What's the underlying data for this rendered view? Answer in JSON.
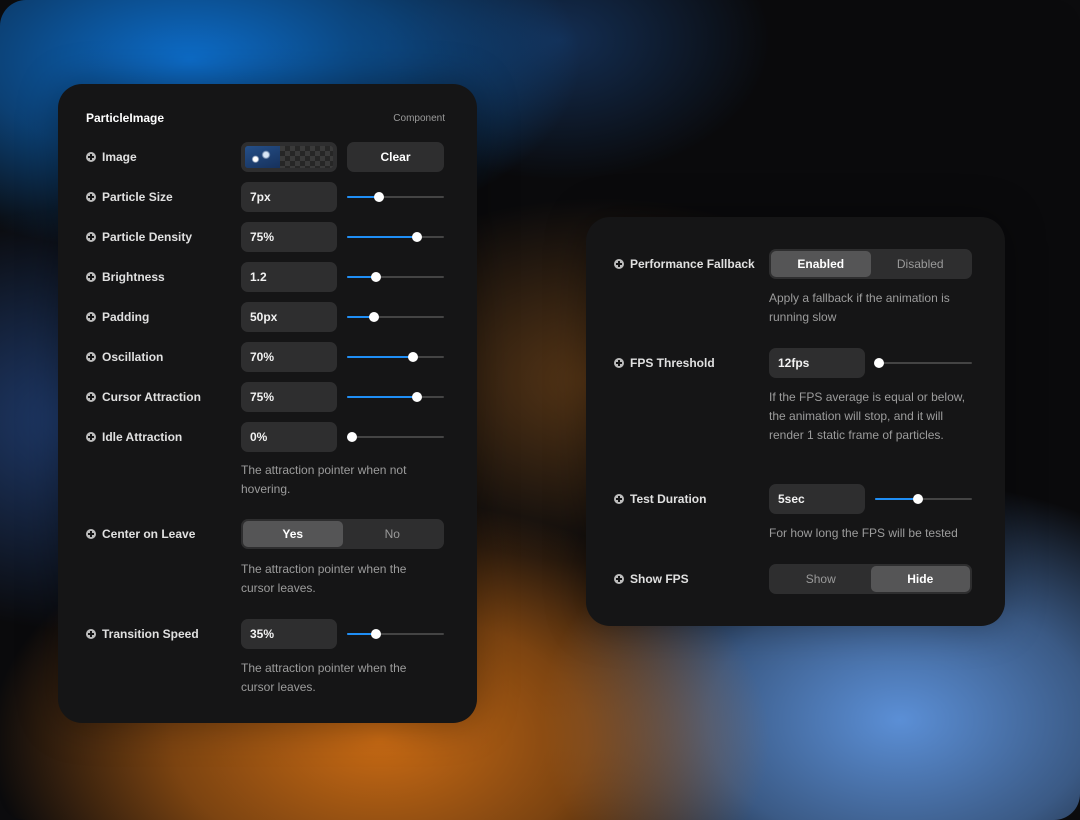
{
  "left_panel": {
    "title": "ParticleImage",
    "type_label": "Component",
    "image": {
      "label": "Image",
      "clear_label": "Clear"
    },
    "particle_size": {
      "label": "Particle Size",
      "value": "7px",
      "level": 0.33
    },
    "particle_density": {
      "label": "Particle Density",
      "value": "75%",
      "level": 0.72
    },
    "brightness": {
      "label": "Brightness",
      "value": "1.2",
      "level": 0.3
    },
    "padding": {
      "label": "Padding",
      "value": "50px",
      "level": 0.28
    },
    "oscillation": {
      "label": "Oscillation",
      "value": "70%",
      "level": 0.68
    },
    "cursor_attraction": {
      "label": "Cursor Attraction",
      "value": "75%",
      "level": 0.72
    },
    "idle_attraction": {
      "label": "Idle Attraction",
      "value": "0%",
      "level": 0.05,
      "description": "The attraction pointer when not hovering."
    },
    "center_on_leave": {
      "label": "Center on Leave",
      "options": [
        "Yes",
        "No"
      ],
      "selected": "Yes",
      "description": "The attraction pointer when the cursor leaves."
    },
    "transition_speed": {
      "label": "Transition Speed",
      "value": "35%",
      "level": 0.3,
      "description": "The attraction pointer when the cursor leaves."
    }
  },
  "right_panel": {
    "performance_fallback": {
      "label": "Performance Fallback",
      "options": [
        "Enabled",
        "Disabled"
      ],
      "selected": "Enabled",
      "description": "Apply a fallback if the animation is running slow"
    },
    "fps_threshold": {
      "label": "FPS Threshold",
      "value": "12fps",
      "level": 0.04,
      "description": "If the FPS average is equal or below, the animation will stop, and it will render 1 static frame of particles."
    },
    "test_duration": {
      "label": "Test Duration",
      "value": "5sec",
      "level": 0.44,
      "description": "For how long the FPS will be tested"
    },
    "show_fps": {
      "label": "Show FPS",
      "options": [
        "Show",
        "Hide"
      ],
      "selected": "Hide"
    }
  },
  "colors": {
    "accent": "#1f8ef5",
    "panel": "#151516",
    "field": "#2e2e2f"
  },
  "icons": {
    "row_icon": "plus-circle-icon"
  }
}
